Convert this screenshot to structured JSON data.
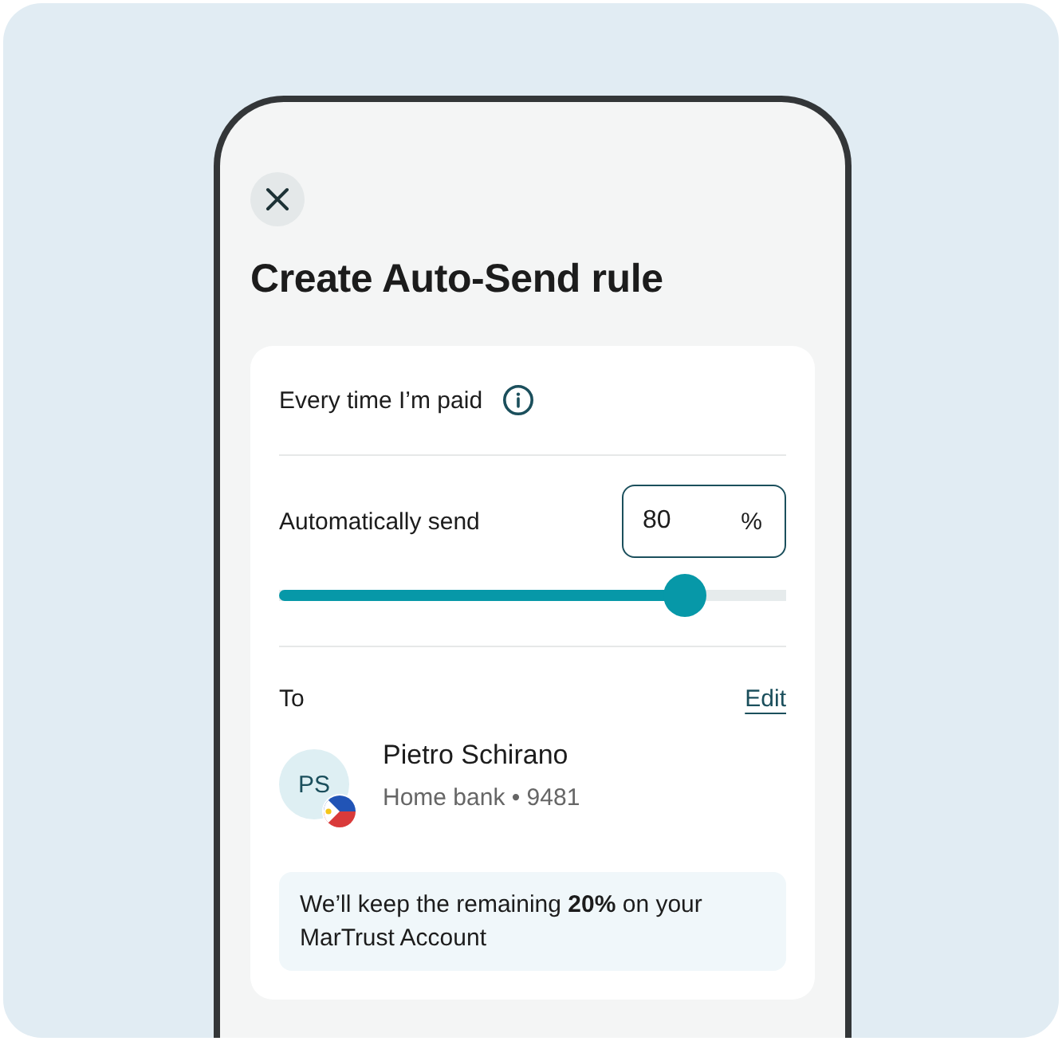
{
  "title": "Create Auto-Send rule",
  "trigger": {
    "label": "Every time I’m paid"
  },
  "amount": {
    "label": "Automatically send",
    "value": "80",
    "unit": "%",
    "level": 0.8
  },
  "recipient": {
    "heading": "To",
    "edit_link": "Edit",
    "initials": "PS",
    "name": "Pietro Schirano",
    "account": "Home bank • 9481"
  },
  "note": "We’ll keep the remaining **20%** on your MarTrust Account"
}
